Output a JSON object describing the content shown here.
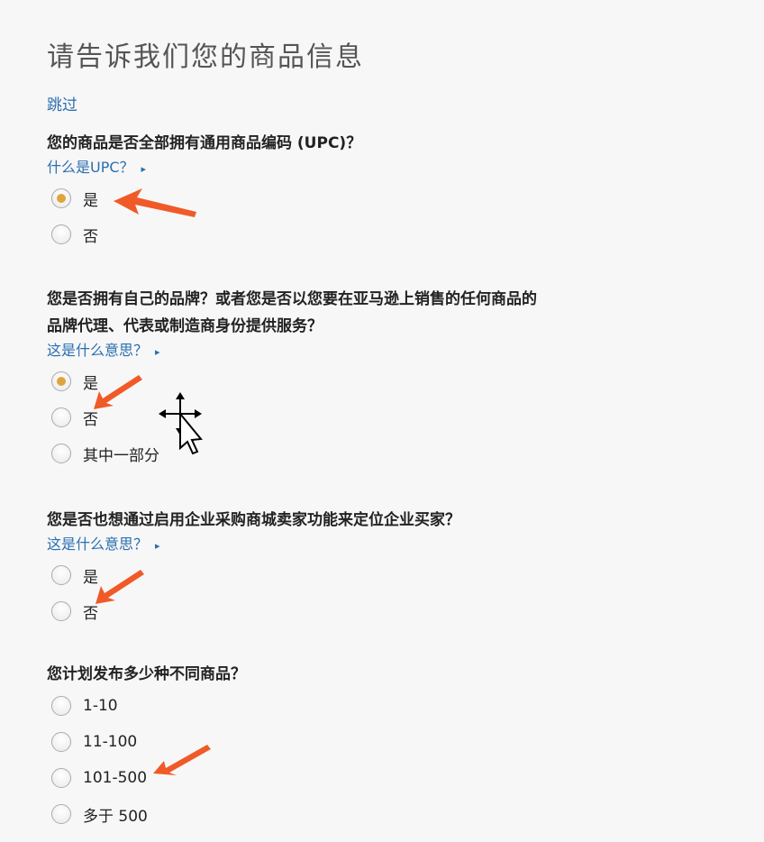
{
  "page": {
    "title": "请告诉我们您的商品信息",
    "skip_label": "跳过"
  },
  "q1": {
    "question": "您的商品是否全部拥有通用商品编码 (UPC)？",
    "help_link": "什么是UPC？",
    "options": [
      "是",
      "否"
    ],
    "selected": 0
  },
  "q2": {
    "question_line1": "您是否拥有自己的品牌？或者您是否以您要在亚马逊上销售的任何商品的",
    "question_line2": "品牌代理、代表或制造商身份提供服务？",
    "help_link": "这是什么意思？",
    "options": [
      "是",
      "否",
      "其中一部分"
    ],
    "selected": 0
  },
  "q3": {
    "question": "您是否也想通过启用企业采购商城卖家功能来定位企业买家？",
    "help_link": "这是什么意思？",
    "options": [
      "是",
      "否"
    ],
    "selected": null
  },
  "q4": {
    "question": "您计划发布多少种不同商品？",
    "options": [
      "1-10",
      "11-100",
      "101-500",
      "多于 500"
    ],
    "selected": null
  },
  "colors": {
    "link": "#2a6fb0",
    "radio_selected": "#e0a43c",
    "annotation_arrow": "#f05a28"
  },
  "icons": {
    "help_caret": "caret-right-icon",
    "annotation": "red-arrow-icon",
    "cursor": "move-cursor-icon"
  }
}
